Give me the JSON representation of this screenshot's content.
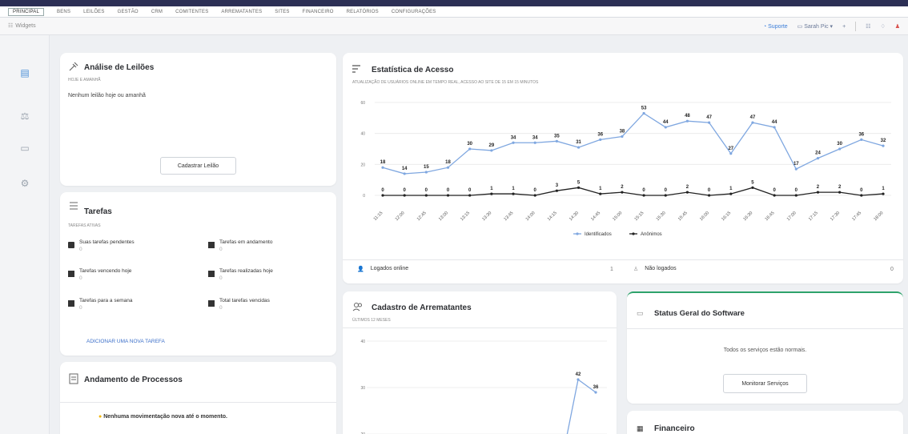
{
  "menu": {
    "items": [
      "PRINCIPAL",
      "BENS",
      "LEILÕES",
      "GESTÃO",
      "CRM",
      "COMITENTES",
      "ARREMATANTES",
      "SITES",
      "FINANCEIRO",
      "RELATÓRIOS",
      "CONFIGURAÇÕES"
    ],
    "active": "PRINCIPAL"
  },
  "toolbar": {
    "left_label": "Widgets",
    "suporte": "Suporte",
    "user": "Sarah Pic"
  },
  "leiloes": {
    "title": "Análise de Leilões",
    "subtitle": "HOJE E AMANHÃ",
    "empty_text": "Nenhum leilão hoje ou amanhã",
    "button": "Cadastrar Leilão"
  },
  "tarefas": {
    "title": "Tarefas",
    "subtitle": "TAREFAS ATIVAS",
    "items": [
      {
        "label": "Suas tarefas pendentes",
        "count": "0"
      },
      {
        "label": "Tarefas em andamento",
        "count": "0"
      },
      {
        "label": "Tarefas vencendo hoje",
        "count": "0"
      },
      {
        "label": "Tarefas realizadas hoje",
        "count": "0"
      },
      {
        "label": "Tarefas para a semana",
        "count": "0"
      },
      {
        "label": "Total tarefas vencidas",
        "count": "0"
      }
    ],
    "link": "ADICIONAR UMA NOVA TAREFA"
  },
  "processos": {
    "title": "Andamento de Processos",
    "message": "Nenhuma movimentação nova até o momento."
  },
  "estatistica": {
    "title": "Estatística de Acesso",
    "subtitle": "ATUALIZAÇÃO DE USUÁRIOS ONLINE EM TEMPO REAL, ACESSO AO SITE DE 15 EM 15 MINUTOS",
    "logados_label": "Logados online",
    "logados_value": "1",
    "naologados_label": "Não logados",
    "naologados_value": "0"
  },
  "arrematantes": {
    "title": "Cadastro de Arrematantes",
    "subtitle": "ÚLTIMOS 12 MESES",
    "chart_data": {
      "type": "line",
      "y_ticks": [
        "40",
        "30",
        "20"
      ],
      "values": [
        42,
        36
      ]
    }
  },
  "status": {
    "title": "Status Geral do Software",
    "message": "Todos os serviços estão normais.",
    "button": "Monitorar Serviços",
    "accent": "#2ea36b"
  },
  "financeiro": {
    "title": "Financeiro"
  },
  "chart_data": {
    "type": "line",
    "categories": [
      "11:15",
      "12:00",
      "12:45",
      "13:00",
      "13:15",
      "13:30",
      "13:45",
      "14:00",
      "14:15",
      "14:30",
      "14:45",
      "15:00",
      "15:15",
      "15:30",
      "15:45",
      "16:00",
      "16:15",
      "16:30",
      "16:45",
      "17:00",
      "17:15",
      "17:30",
      "17:45",
      "18:00"
    ],
    "y_ticks": [
      0,
      20,
      40,
      60
    ],
    "ylim": [
      0,
      60
    ],
    "series": [
      {
        "name": "Identificados",
        "color": "#7fa7e0",
        "values": [
          18,
          14,
          15,
          18,
          30,
          29,
          34,
          34,
          35,
          31,
          36,
          38,
          53,
          44,
          48,
          47,
          27,
          47,
          44,
          17,
          24,
          30,
          36,
          32
        ]
      },
      {
        "name": "Anônimos",
        "color": "#222222",
        "values": [
          0,
          0,
          0,
          0,
          0,
          1,
          1,
          0,
          3,
          5,
          1,
          2,
          0,
          0,
          2,
          0,
          1,
          5,
          0,
          0,
          2,
          2,
          0,
          1
        ]
      }
    ],
    "legend_position": "bottom"
  }
}
